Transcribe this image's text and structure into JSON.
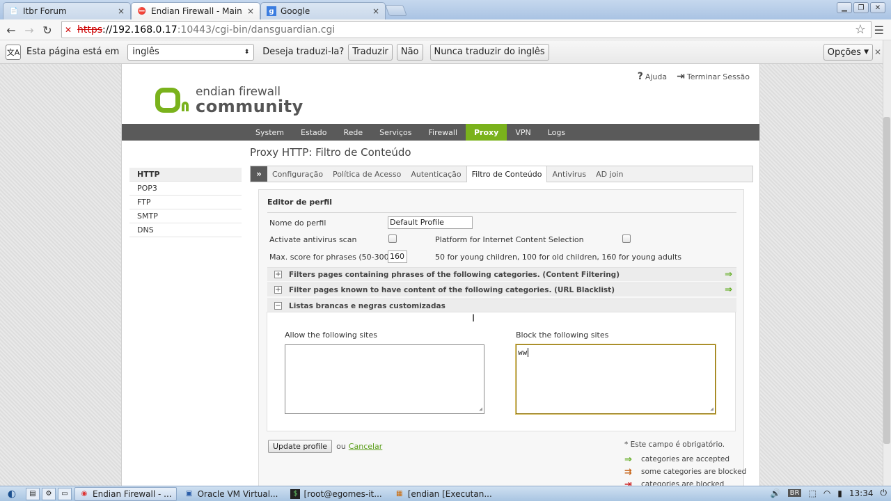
{
  "browser": {
    "tabs": [
      {
        "title": "Itbr Forum",
        "icon": "document-icon"
      },
      {
        "title": "Endian Firewall - Main pag",
        "icon": "blocked-icon"
      },
      {
        "title": "Google",
        "icon": "google-icon"
      }
    ],
    "close_glyph": "×",
    "address": {
      "scheme": "https",
      "sep": "://",
      "host": "192.168.0.17",
      "path": ":10443/cgi-bin/dansguardian.cgi"
    },
    "translate": {
      "prompt": "Esta página está em",
      "language": "inglês",
      "question": "Deseja traduzi-la?",
      "translate_btn": "Traduzir",
      "no_btn": "Não",
      "never_btn": "Nunca traduzir do inglês",
      "options_btn": "Opções"
    }
  },
  "page": {
    "header_links": {
      "help": "Ajuda",
      "logout": "Terminar Sessão"
    },
    "logo": {
      "line1": "endian firewall",
      "line2": "community"
    },
    "main_nav": [
      "System",
      "Estado",
      "Rede",
      "Serviços",
      "Firewall",
      "Proxy",
      "VPN",
      "Logs"
    ],
    "active_nav": "Proxy",
    "heading": "Proxy HTTP: Filtro de Conteúdo",
    "side_menu": [
      "HTTP",
      "POP3",
      "FTP",
      "SMTP",
      "DNS"
    ],
    "sub_tabs": [
      "Configuração",
      "Política de Acesso",
      "Autenticação",
      "Filtro de Conteúdo",
      "Antivirus",
      "AD join"
    ],
    "active_sub_tab": "Filtro de Conteúdo",
    "collapse_glyph": "»",
    "editor": {
      "title": "Editor de perfil",
      "profile_label": "Nome do perfil",
      "profile_value": "Default Profile",
      "antivirus_label": "Activate antivirus scan",
      "pics_label": "Platform for Internet Content Selection",
      "score_label": "Max. score for phrases (50-300)",
      "score_value": "160",
      "score_hint": "50 for young children, 100 for old children, 160 for young adults",
      "sections": [
        {
          "label": "Filters pages containing phrases of the following categories. (Content Filtering)",
          "toggle": "+"
        },
        {
          "label": "Filter pages known to have content of the following categories. (URL Blacklist)",
          "toggle": "+"
        },
        {
          "label": "Listas brancas e negras customizadas",
          "toggle": "−"
        }
      ],
      "allow_label": "Allow the following sites",
      "allow_value": "",
      "block_label": "Block the following sites",
      "block_value": "ww"
    },
    "update_btn": "Update profile",
    "or_text": "ou",
    "cancel_link": "Cancelar",
    "legend": {
      "required": "* Este campo é obrigatório.",
      "accepted": "categories are accepted",
      "some_blocked": "some categories are blocked",
      "blocked": "categories are blocked"
    }
  },
  "taskbar": {
    "items": [
      {
        "label": "Endian Firewall - ...",
        "icon": "chrome-icon"
      },
      {
        "label": "Oracle VM Virtual...",
        "icon": "virtualbox-icon"
      },
      {
        "label": "[root@egomes-it...",
        "icon": "terminal-icon"
      },
      {
        "label": "[endian [Executan...",
        "icon": "vm-window-icon"
      }
    ],
    "keyboard": "BR",
    "clock": "13:34"
  },
  "colors": {
    "accent_green": "#7ab21c",
    "nav_bg": "#5a5a5a",
    "error_red": "#cc0000"
  }
}
